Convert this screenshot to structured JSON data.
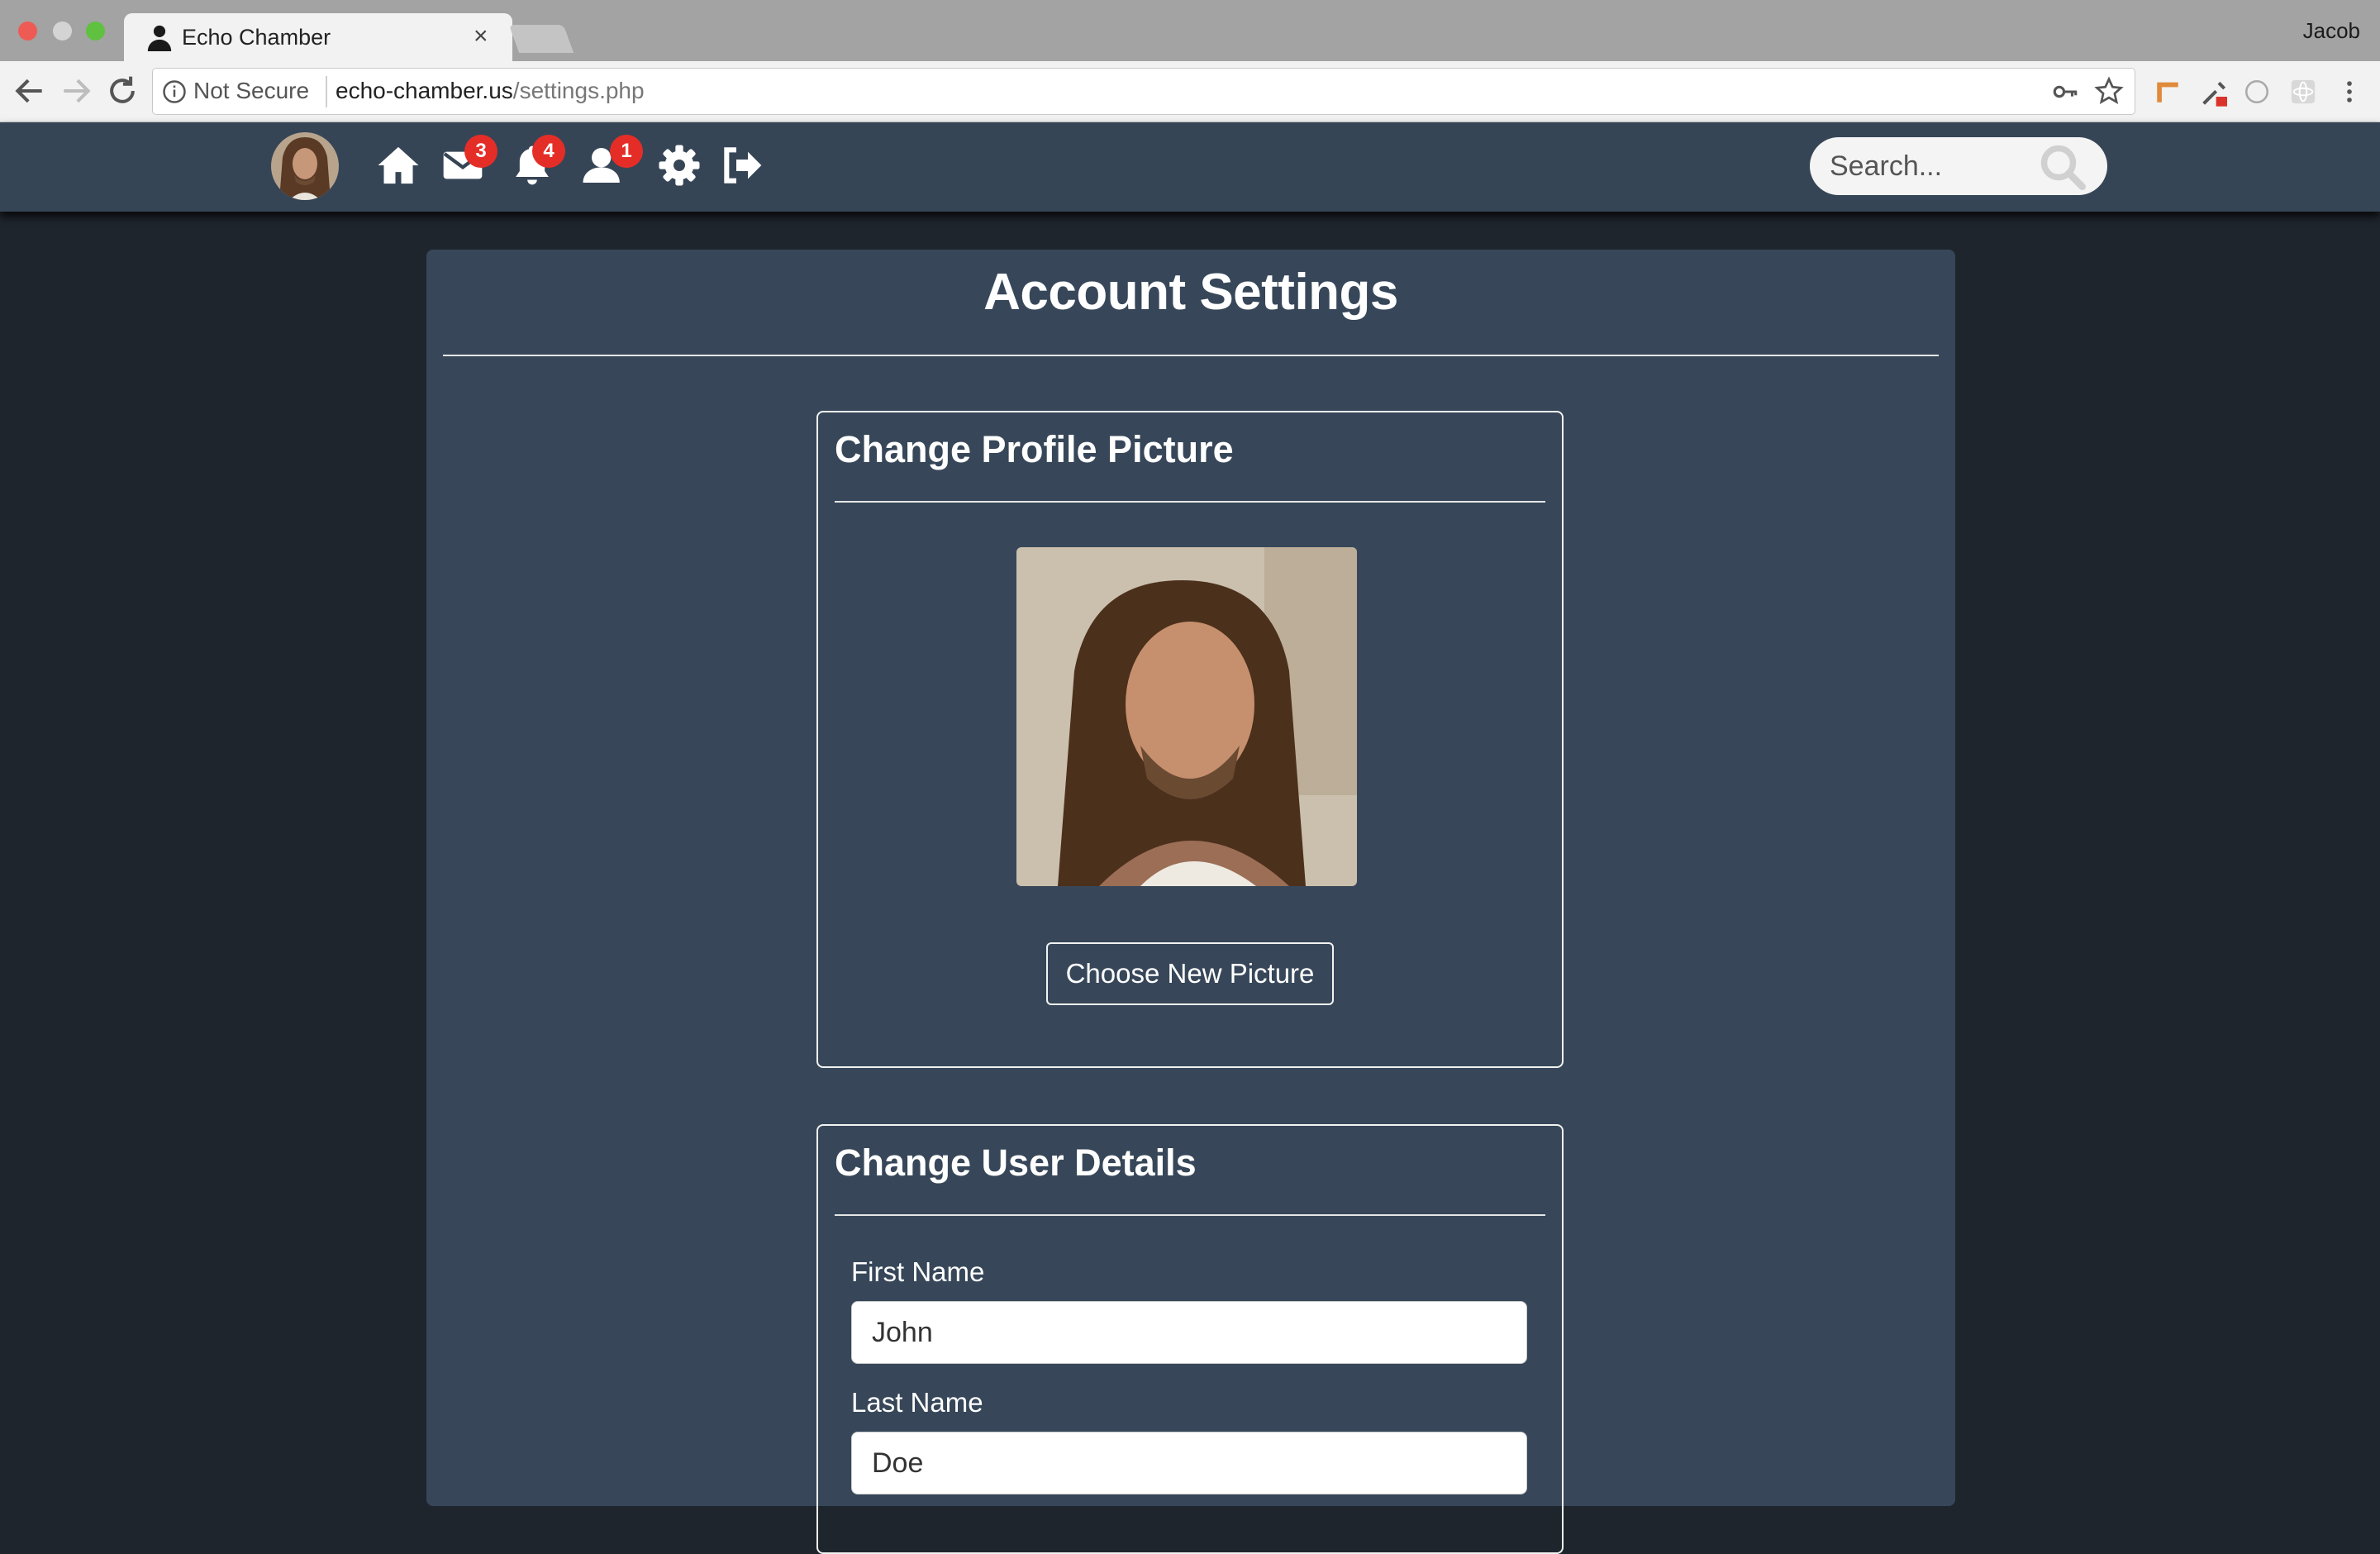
{
  "browser": {
    "tab_title": "Echo Chamber",
    "tab_close": "×",
    "profile_name": "Jacob",
    "security_label": "Not Secure",
    "url_host": "echo-chamber.us",
    "url_path": "/settings.php"
  },
  "navbar": {
    "icons": [
      "home-icon",
      "envelope-icon",
      "bell-icon",
      "user-icon",
      "gear-icon",
      "sign-out-icon"
    ],
    "badges": {
      "messages": "3",
      "notifications": "4",
      "friend_requests": "1"
    },
    "search_placeholder": "Search..."
  },
  "page": {
    "title": "Account Settings",
    "profile_section": {
      "title": "Change Profile Picture",
      "button": "Choose New Picture"
    },
    "details_section": {
      "title": "Change User Details",
      "first_name_label": "First Name",
      "first_name_value": "John",
      "last_name_label": "Last Name",
      "last_name_value": "Doe"
    }
  },
  "colors": {
    "navbar": "#364556",
    "background": "#1f252d",
    "card": "#374759",
    "badge": "#e52d27"
  }
}
